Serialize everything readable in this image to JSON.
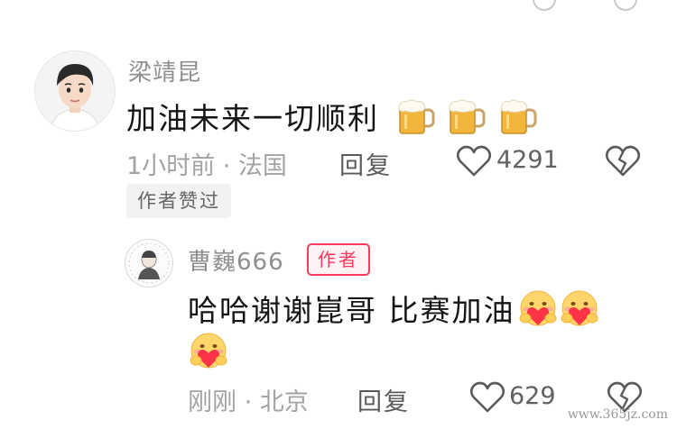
{
  "comment": {
    "author": "梁靖昆",
    "text": "加油未来一切顺利",
    "emojis": [
      "beer-mug-emoji",
      "beer-mug-emoji",
      "beer-mug-emoji"
    ],
    "time_location": "1小时前 · 法国",
    "reply_label": "回复",
    "like_count": "4291",
    "liked_by_author_tag": "作者赞过"
  },
  "reply": {
    "author": "曹巍666",
    "author_badge": "作者",
    "text": "哈哈谢谢崑哥 比赛加油",
    "emojis": [
      "hug-heart-emoji",
      "hug-heart-emoji",
      "hug-heart-emoji"
    ],
    "time_location": "刚刚 · 北京",
    "reply_label": "回复",
    "like_count": "629"
  },
  "watermark": "www.365jz.com",
  "colors": {
    "badge": "#ff3b5c",
    "name": "#8f8f8f",
    "meta": "#a3a3a3",
    "text": "#151515"
  }
}
